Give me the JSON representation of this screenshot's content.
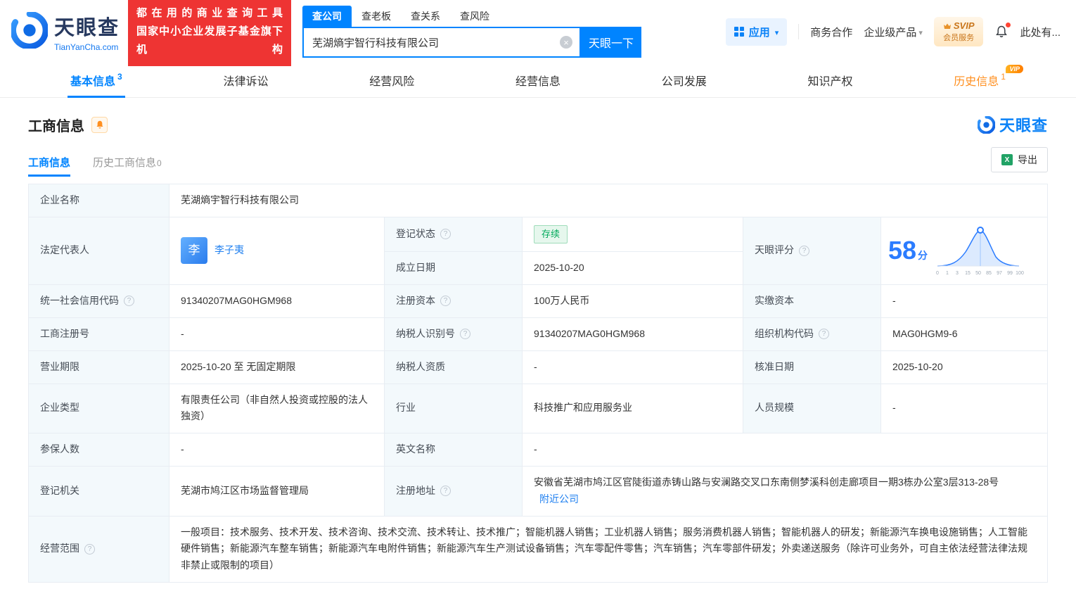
{
  "colors": {
    "brand_blue": "#0084ff",
    "link_blue": "#2080f0",
    "score_blue": "#2b7cff",
    "banner_red": "#ee3433",
    "vip_orange": "#ff8f1f",
    "status_green": "#00aa5b",
    "label_cell_bg": "#f3f9fc"
  },
  "header": {
    "logo": {
      "cn": "天眼查",
      "en": "TianYanCha.com"
    },
    "banner": {
      "line1": "都在用的商业查询工具",
      "line2": "国家中小企业发展子基金旗下机构"
    },
    "search_tabs": [
      {
        "label": "查公司"
      },
      {
        "label": "查老板"
      },
      {
        "label": "查关系"
      },
      {
        "label": "查风险"
      }
    ],
    "search": {
      "value": "芜湖熵宇智行科技有限公司",
      "button_label": "天眼一下"
    },
    "right": {
      "app_label": "应用",
      "biz_label": "商务合作",
      "enterprise_label": "企业级产品",
      "svip_line1": "SVIP",
      "svip_line2": "会员服务",
      "more_label": "此处有..."
    }
  },
  "nav_tabs": {
    "vip_badge": "VIP",
    "items": [
      {
        "label": "基本信息",
        "count": "3"
      },
      {
        "label": "法律诉讼"
      },
      {
        "label": "经营风险"
      },
      {
        "label": "经营信息"
      },
      {
        "label": "公司发展"
      },
      {
        "label": "知识产权"
      },
      {
        "label": "历史信息",
        "count": "1"
      }
    ]
  },
  "section": {
    "title": "工商信息",
    "brand": "天眼查",
    "subtab_active": "工商信息",
    "subtab_history": "历史工商信息",
    "subtab_history_count": "0",
    "export_label": "导出"
  },
  "table": {
    "company_name": {
      "label": "企业名称",
      "value": "芜湖熵宇智行科技有限公司"
    },
    "legal_rep": {
      "label": "法定代表人",
      "avatar": "李",
      "name": "李子夷"
    },
    "reg_status": {
      "label": "登记状态",
      "value": "存续"
    },
    "establish_date": {
      "label": "成立日期",
      "value": "2025-10-20"
    },
    "score": {
      "label": "天眼评分",
      "value": "58",
      "unit": "分",
      "axis": [
        "0",
        "1",
        "3",
        "15",
        "50",
        "85",
        "97",
        "99",
        "100"
      ]
    },
    "credit_code": {
      "label": "统一社会信用代码",
      "value": "91340207MAG0HGM968"
    },
    "reg_capital": {
      "label": "注册资本",
      "value": "100万人民币"
    },
    "paid_capital": {
      "label": "实缴资本",
      "value": "-"
    },
    "reg_number": {
      "label": "工商注册号",
      "value": "-"
    },
    "taxpayer_id": {
      "label": "纳税人识别号",
      "value": "91340207MAG0HGM968"
    },
    "org_code": {
      "label": "组织机构代码",
      "value": "MAG0HGM9-6"
    },
    "business_term": {
      "label": "营业期限",
      "value": "2025-10-20 至 无固定期限"
    },
    "taxpayer_quality": {
      "label": "纳税人资质",
      "value": "-"
    },
    "approval_date": {
      "label": "核准日期",
      "value": "2025-10-20"
    },
    "company_type": {
      "label": "企业类型",
      "value": "有限责任公司（非自然人投资或控股的法人独资）"
    },
    "industry": {
      "label": "行业",
      "value": "科技推广和应用服务业"
    },
    "staff_size": {
      "label": "人员规模",
      "value": "-"
    },
    "insured_count": {
      "label": "参保人数",
      "value": "-"
    },
    "english_name": {
      "label": "英文名称",
      "value": "-"
    },
    "reg_authority": {
      "label": "登记机关",
      "value": "芜湖市鸠江区市场监督管理局"
    },
    "reg_address": {
      "label": "注册地址",
      "value": "安徽省芜湖市鸠江区官陡街道赤铸山路与安澜路交叉口东南侧梦溪科创走廊项目一期3栋办公室3层313-28号",
      "link": "附近公司"
    },
    "business_scope": {
      "label": "经营范围",
      "value": "一般项目：技术服务、技术开发、技术咨询、技术交流、技术转让、技术推广；智能机器人销售；工业机器人销售；服务消费机器人销售；智能机器人的研发；新能源汽车换电设施销售；人工智能硬件销售；新能源汽车整车销售；新能源汽车电附件销售；新能源汽车生产测试设备销售；汽车零配件零售；汽车销售；汽车零部件研发；外卖递送服务（除许可业务外，可自主依法经营法律法规非禁止或限制的项目）"
    }
  }
}
